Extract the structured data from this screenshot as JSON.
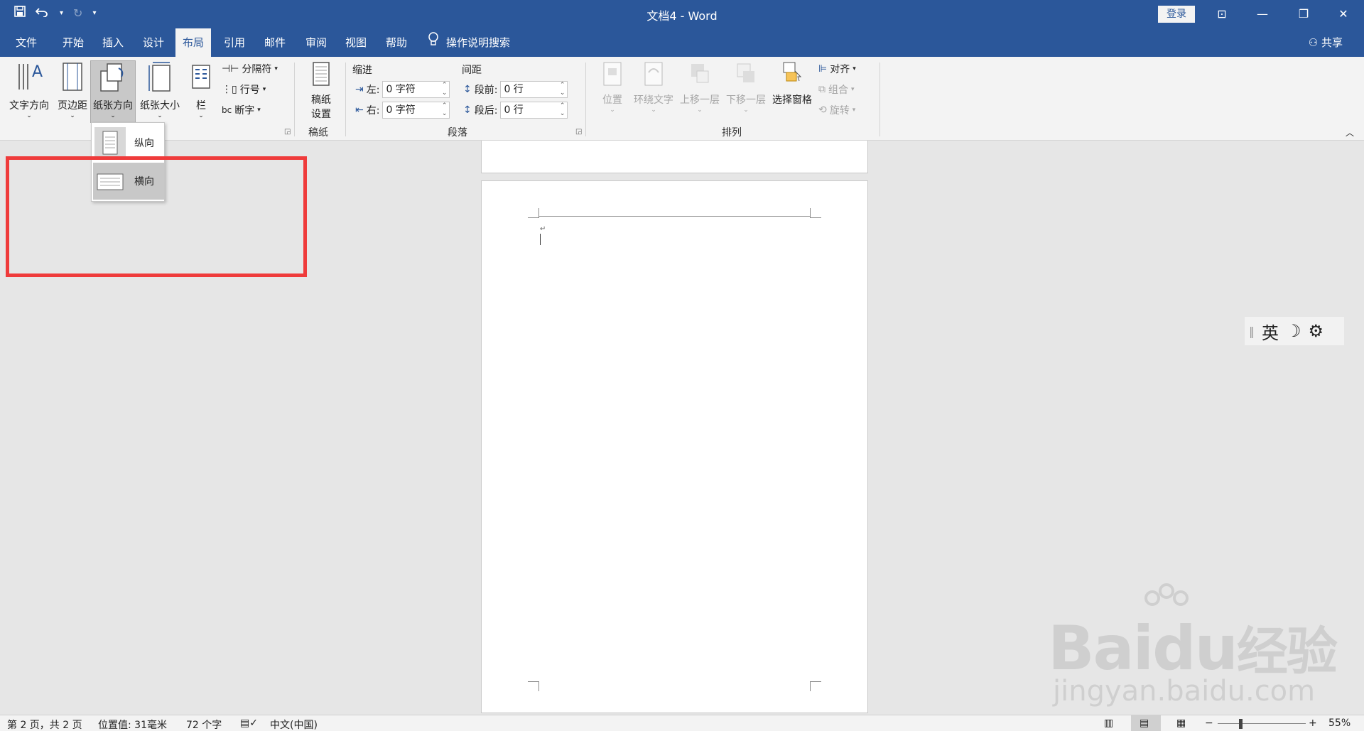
{
  "title_bar": {
    "doc_title": "文档4  -  Word",
    "login": "登录",
    "minimize": "—",
    "restore": "❐",
    "close": "✕",
    "ribbon_display": "⊡"
  },
  "tabs": [
    {
      "label": "文件"
    },
    {
      "label": "开始"
    },
    {
      "label": "插入"
    },
    {
      "label": "设计"
    },
    {
      "label": "布局"
    },
    {
      "label": "引用"
    },
    {
      "label": "邮件"
    },
    {
      "label": "审阅"
    },
    {
      "label": "视图"
    },
    {
      "label": "帮助"
    }
  ],
  "tell_me": "操作说明搜索",
  "share": "共享",
  "page_setup": {
    "text_direction": "文字方向",
    "margins": "页边距",
    "orientation": "纸张方向",
    "size": "纸张大小",
    "columns": "栏",
    "breaks": "分隔符",
    "line_numbers": "行号",
    "hyphenation": "断字"
  },
  "manuscript": {
    "line1": "稿纸",
    "line2": "设置",
    "group": "稿纸"
  },
  "paragraph": {
    "indent_title": "缩进",
    "spacing_title": "间距",
    "left_label": "左:",
    "right_label": "右:",
    "before_label": "段前:",
    "after_label": "段后:",
    "left_value": "0 字符",
    "right_value": "0 字符",
    "before_value": "0 行",
    "after_value": "0 行",
    "group": "段落"
  },
  "arrange": {
    "position": "位置",
    "wrap": "环绕文字",
    "forward": "上移一层",
    "backward": "下移一层",
    "selection_pane": "选择窗格",
    "align": "对齐",
    "group_btn": "组合",
    "rotate": "旋转",
    "group": "排列"
  },
  "orientation_menu": {
    "portrait": "纵向",
    "landscape": "横向"
  },
  "ime": {
    "mode": "英"
  },
  "watermark": {
    "brand": "Bai",
    "brand2": "du",
    "cn": "经验",
    "url": "jingyan.baidu.com"
  },
  "status": {
    "page": "第 2 页，共 2 页",
    "position": "位置值: 31毫米",
    "words": "72 个字",
    "language": "中文(中国)",
    "zoom": "55%"
  }
}
